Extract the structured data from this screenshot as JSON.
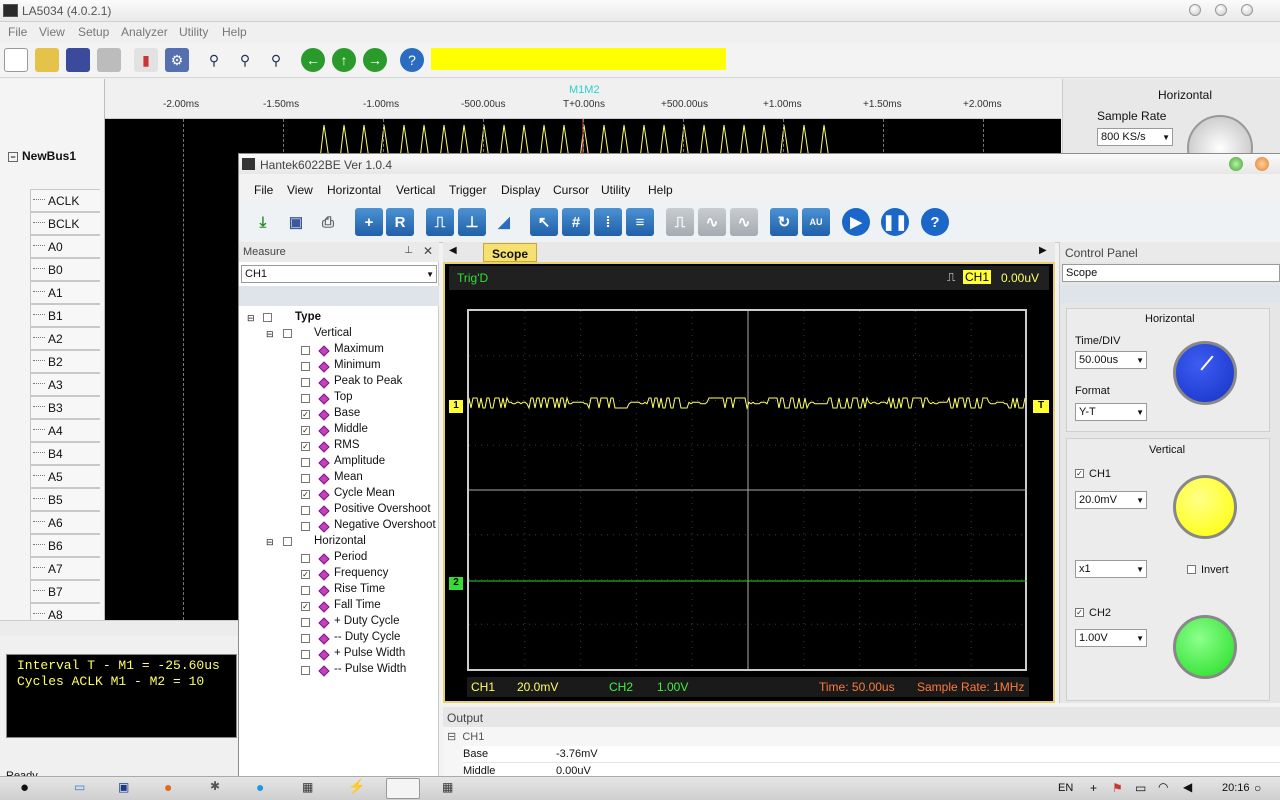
{
  "la": {
    "title": "LA5034 (4.0.2.1)",
    "menu": [
      "File",
      "View",
      "Setup",
      "Analyzer",
      "Utility",
      "Help"
    ],
    "bus": "NewBus1",
    "signals": [
      "ACLK",
      "BCLK",
      "A0",
      "B0",
      "A1",
      "B1",
      "A2",
      "B2",
      "A3",
      "B3",
      "A4",
      "B4",
      "A5",
      "B5",
      "A6",
      "B6",
      "A7",
      "B7",
      "A8"
    ],
    "ruler": [
      "-2.00ms",
      "-1.50ms",
      "-1.00ms",
      "-500.00us",
      "T+0.00ns",
      "+500.00us",
      "+1.00ms",
      "+1.50ms",
      "+2.00ms"
    ],
    "marker": "M1M2",
    "horizontal": "Horizontal",
    "sample_rate_label": "Sample Rate",
    "sample_rate": "800 KS/s",
    "info": [
      "Interval  T - M1 = -25.60us",
      "Cycles  ACLK  M1 - M2 = 10"
    ],
    "status": "Ready"
  },
  "hk": {
    "title": "Hantek6022BE Ver 1.0.4",
    "menu": [
      "File",
      "View",
      "Horizontal",
      "Vertical",
      "Trigger",
      "Display",
      "Cursor",
      "Utility",
      "Help"
    ],
    "measure": {
      "header": "Measure",
      "channel": "CH1",
      "root": "Type",
      "vertical": "Vertical",
      "vertical_items": [
        {
          "label": "Maximum",
          "checked": false
        },
        {
          "label": "Minimum",
          "checked": false
        },
        {
          "label": "Peak to Peak",
          "checked": false
        },
        {
          "label": "Top",
          "checked": false
        },
        {
          "label": "Base",
          "checked": true
        },
        {
          "label": "Middle",
          "checked": true
        },
        {
          "label": "RMS",
          "checked": true
        },
        {
          "label": "Amplitude",
          "checked": false
        },
        {
          "label": "Mean",
          "checked": false
        },
        {
          "label": "Cycle Mean",
          "checked": true
        },
        {
          "label": "Positive Overshoot",
          "checked": false
        },
        {
          "label": "Negative Overshoot",
          "checked": false
        }
      ],
      "horizontal": "Horizontal",
      "horizontal_items": [
        {
          "label": "Period",
          "checked": false
        },
        {
          "label": "Frequency",
          "checked": true
        },
        {
          "label": "Rise Time",
          "checked": false
        },
        {
          "label": "Fall Time",
          "checked": true
        },
        {
          "label": "+ Duty Cycle",
          "checked": false
        },
        {
          "label": "-- Duty Cycle",
          "checked": false
        },
        {
          "label": "+ Pulse Width",
          "checked": false
        },
        {
          "label": "-- Pulse Width",
          "checked": false
        }
      ]
    },
    "scope": {
      "tab": "Scope",
      "trig_state": "Trig'D",
      "trig_channel": "CH1",
      "trig_level": "0.00uV",
      "ch1_marker": "1",
      "ch2_marker": "2",
      "trig_marker": "T",
      "ch1_scale_label": "CH1",
      "ch1_scale": "20.0mV",
      "ch2_scale_label": "CH2",
      "ch2_scale": "1.00V",
      "time": "Time: 50.00us",
      "sample_rate": "Sample Rate: 1MHz",
      "ch1_color": "#ffff66",
      "ch2_color": "#33cc33"
    },
    "output": {
      "header": "Output",
      "group": "CH1",
      "rows": [
        {
          "name": "Base",
          "value": "-3.76mV"
        },
        {
          "name": "Middle",
          "value": "0.00uV"
        }
      ]
    },
    "control": {
      "header": "Control Panel",
      "mode": "Scope",
      "horizontal": "Horizontal",
      "timediv_label": "Time/DIV",
      "timediv": "50.00us",
      "format_label": "Format",
      "format": "Y-T",
      "vertical": "Vertical",
      "ch1_label": "CH1",
      "ch1_volts": "20.0mV",
      "ch1_probe": "x1",
      "invert_label": "Invert",
      "ch2_label": "CH2",
      "ch2_volts": "1.00V",
      "knob_h_color": "#1733c8",
      "knob_ch1_color": "#ffff00",
      "knob_ch2_color": "#22dd22"
    }
  },
  "taskbar": {
    "lang": "EN",
    "clock": "20:16"
  }
}
